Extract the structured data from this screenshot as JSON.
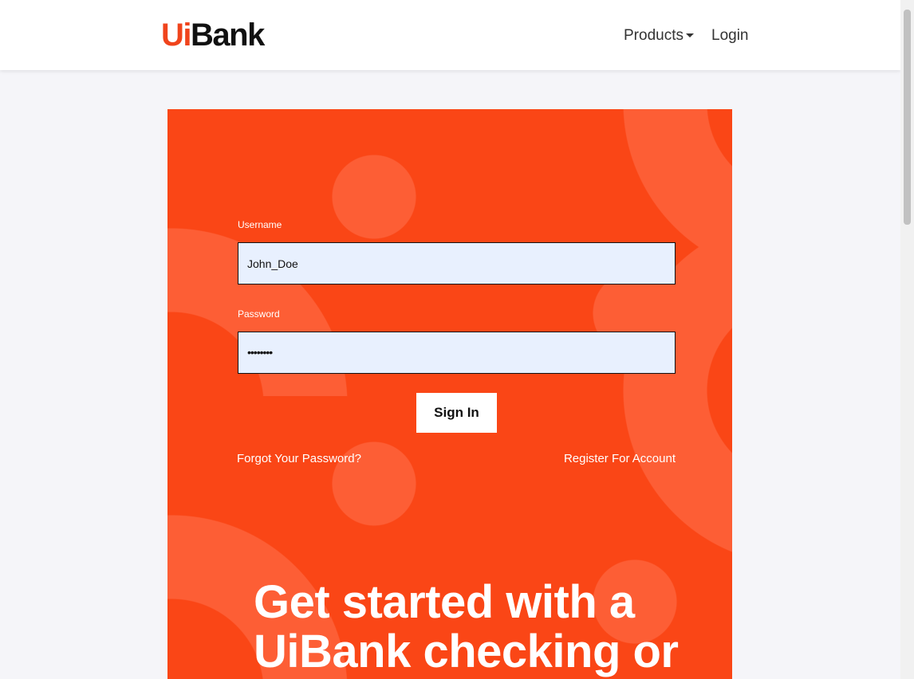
{
  "header": {
    "logo_ui": "Ui",
    "logo_bank": "Bank",
    "nav": {
      "products": "Products",
      "login": "Login"
    }
  },
  "form": {
    "username_label": "Username",
    "username_value": "John_Doe",
    "password_label": "Password",
    "password_value": "••••••••",
    "sign_in": "Sign In",
    "forgot": "Forgot Your Password?",
    "register": "Register For Account"
  },
  "hero": {
    "line1": "Get started with a",
    "line2": "UiBank checking or"
  }
}
